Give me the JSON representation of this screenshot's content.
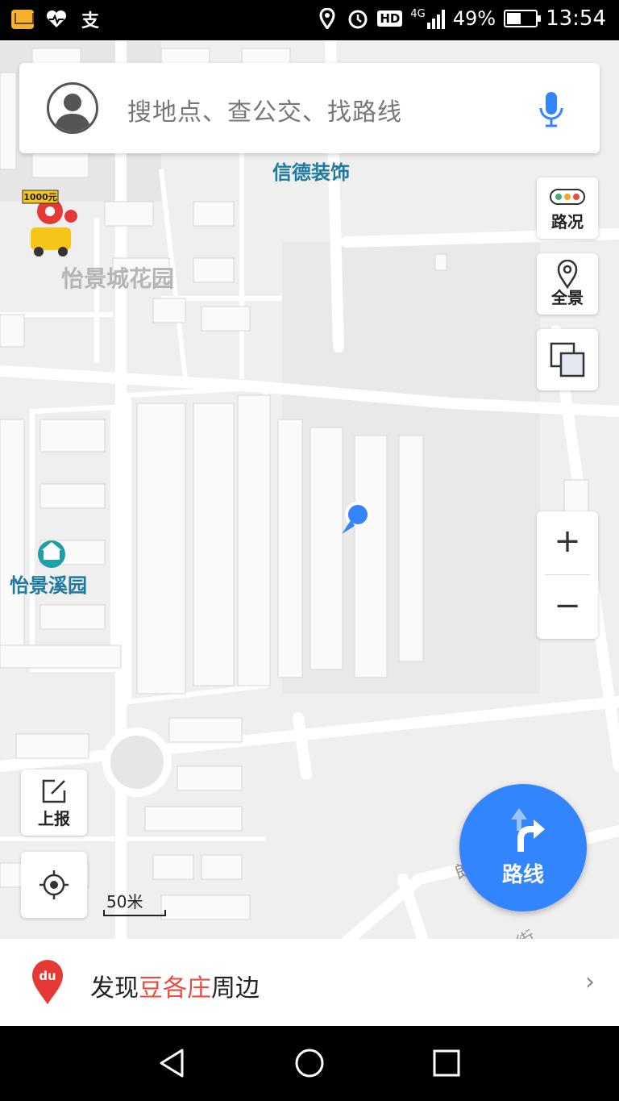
{
  "status_bar": {
    "time": "13:54",
    "battery_percent": "49%",
    "battery_level": 0.49,
    "network": "4G",
    "hd_badge": "HD",
    "left_icons": [
      "mail-icon",
      "health-icon",
      "alipay-icon"
    ],
    "right_icons": [
      "location-icon",
      "alarm-icon",
      "hd-icon",
      "signal-icon",
      "battery-icon"
    ]
  },
  "search": {
    "placeholder": "搜地点、查公交、找路线",
    "left_icon": "avatar-icon",
    "right_icon": "mic-icon"
  },
  "map": {
    "labels": {
      "xinde": "信德装饰",
      "yijing_city": "怡景城花园",
      "yijing_xi": "怡景溪园",
      "promo_badge": "1000元",
      "road_1": "朗街",
      "road_2": "屯村中街"
    },
    "accent_color": "#3385ff",
    "poi_color": "#1e7a9e"
  },
  "controls": {
    "traffic": {
      "label": "路况",
      "icon": "traffic-light-icon"
    },
    "panorama": {
      "label": "全景",
      "icon": "location-pin-icon"
    },
    "layers": {
      "icon": "layers-icon"
    },
    "zoom_in": "+",
    "zoom_out": "−",
    "report": {
      "label": "上报",
      "icon": "edit-icon"
    },
    "locate": {
      "icon": "locate-icon"
    },
    "route": {
      "label": "路线",
      "icon": "route-arrow-icon"
    }
  },
  "scale": {
    "text": "50米"
  },
  "discover": {
    "prefix": "发现",
    "place": "豆各庄",
    "suffix": "周边",
    "pin_text": "du",
    "chevron": "›"
  },
  "nav": {
    "icons": [
      "back-icon",
      "home-icon",
      "recents-icon"
    ]
  }
}
